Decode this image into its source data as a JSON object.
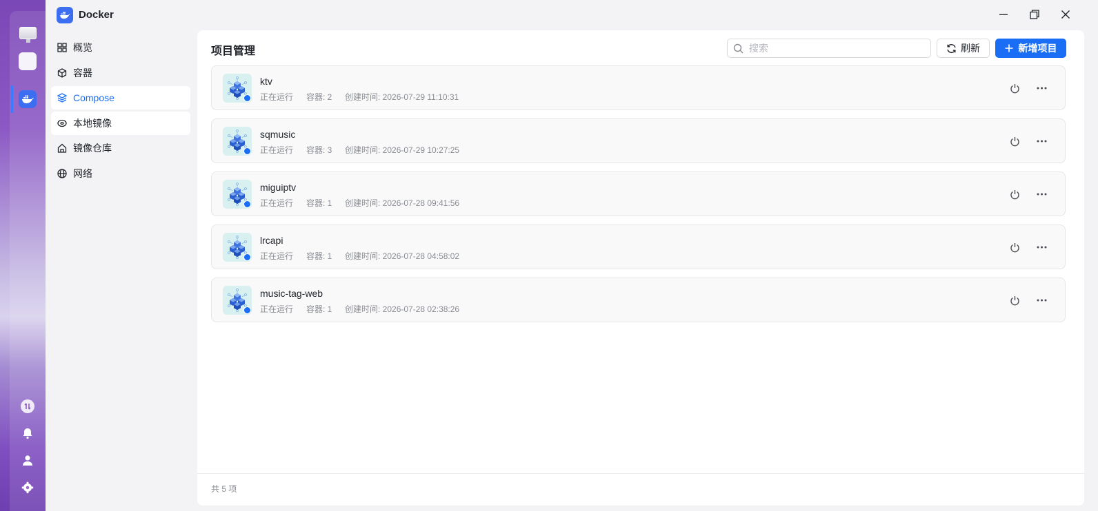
{
  "colors": {
    "accent": "#1a6ef5",
    "dock_gradient_top": "#7a47b6",
    "project_icon_bg": "#d8f0ef",
    "running_dot": "#1a6ef5"
  },
  "dock": {
    "items": [
      {
        "icon": "monitor-icon"
      },
      {
        "icon": "app-grid-icon"
      },
      {
        "icon": "docker-icon",
        "active": true
      },
      {
        "icon": "transfer-icon"
      },
      {
        "icon": "bell-icon"
      },
      {
        "icon": "user-icon"
      },
      {
        "icon": "gear-icon"
      }
    ]
  },
  "window": {
    "title": "Docker",
    "controls": {
      "minimize": "minimize-icon",
      "maximize": "maximize-icon",
      "close": "close-icon"
    }
  },
  "sidebar": {
    "items": [
      {
        "label": "概览",
        "icon": "overview-grid-icon"
      },
      {
        "label": "容器",
        "icon": "cube-icon"
      },
      {
        "label": "Compose",
        "icon": "layers-icon",
        "active": true
      },
      {
        "label": "本地镜像",
        "icon": "disk-icon"
      },
      {
        "label": "镜像仓库",
        "icon": "home-icon"
      },
      {
        "label": "网络",
        "icon": "globe-icon"
      }
    ]
  },
  "main": {
    "title": "项目管理",
    "search": {
      "placeholder": "搜索",
      "value": ""
    },
    "refresh_label": "刷新",
    "add_label": "新增项目",
    "status_label": "正在运行",
    "containers_prefix": "容器: ",
    "created_prefix": "创建时间: ",
    "projects": [
      {
        "name": "ktv",
        "status": "正在运行",
        "containers": "容器: 2",
        "created": "创建时间: 2026-07-29 11:10:31"
      },
      {
        "name": "sqmusic",
        "status": "正在运行",
        "containers": "容器: 3",
        "created": "创建时间: 2026-07-29 10:27:25"
      },
      {
        "name": "miguiptv",
        "status": "正在运行",
        "containers": "容器: 1",
        "created": "创建时间: 2026-07-28 09:41:56"
      },
      {
        "name": "lrcapi",
        "status": "正在运行",
        "containers": "容器: 1",
        "created": "创建时间: 2026-07-28 04:58:02"
      },
      {
        "name": "music-tag-web",
        "status": "正在运行",
        "containers": "容器: 1",
        "created": "创建时间: 2026-07-28 02:38:26"
      }
    ],
    "footer_count": "共 5 项"
  }
}
